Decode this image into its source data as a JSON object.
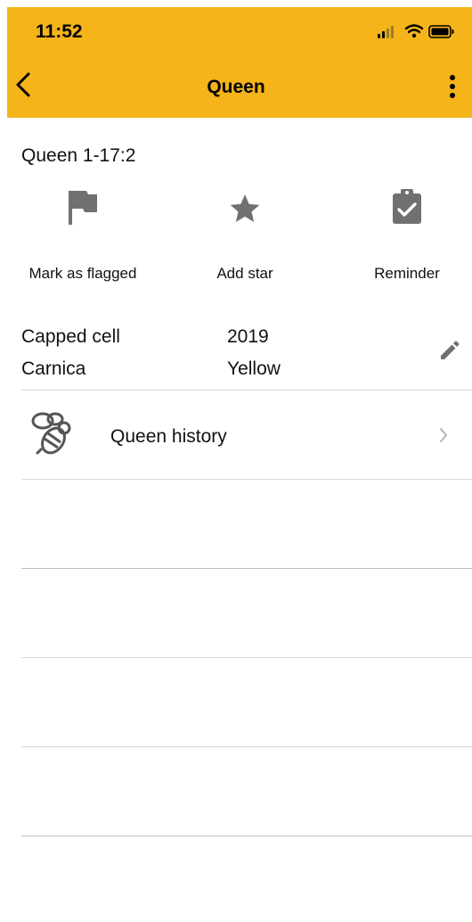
{
  "status_bar": {
    "time": "11:52"
  },
  "nav": {
    "title": "Queen"
  },
  "queen": {
    "name": "Queen 1-17:2"
  },
  "actions": [
    {
      "label": "Mark as flagged",
      "icon": "flag-icon"
    },
    {
      "label": "Add star",
      "icon": "star-icon"
    },
    {
      "label": "Reminder",
      "icon": "clipboard-check-icon"
    }
  ],
  "details": {
    "origin": "Capped cell",
    "year": "2019",
    "breed": "Carnica",
    "color": "Yellow"
  },
  "history": {
    "label": "Queen history",
    "icon": "bee-icon"
  },
  "colors": {
    "accent": "#F4B41A",
    "icon_gray": "#707070",
    "divider": "#d9d9d9"
  }
}
